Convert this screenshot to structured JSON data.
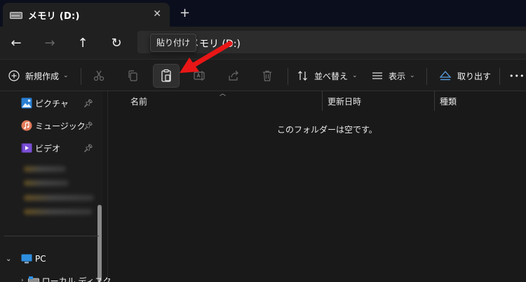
{
  "tab": {
    "title": "メモリ (D:)",
    "close": "✕",
    "new_tab": "+"
  },
  "nav": {
    "back": "←",
    "forward": "→",
    "up": "↑",
    "refresh": "↻"
  },
  "address": {
    "path": "メモリ (D:)",
    "bracket": "〔"
  },
  "tooltip": {
    "text": "貼り付け"
  },
  "toolbar": {
    "new_label": "新規作成",
    "sort_label": "並べ替え",
    "view_label": "表示",
    "eject_label": "取り出す",
    "more": "•••",
    "chevron": "⌄"
  },
  "sidebar": {
    "items": [
      {
        "label": "ピクチャ"
      },
      {
        "label": "ミュージック"
      },
      {
        "label": "ビデオ"
      }
    ],
    "pc_label": "PC",
    "disk_label": "ローカル ディスク"
  },
  "columns": {
    "name": "名前",
    "modified": "更新日時",
    "type": "種類"
  },
  "empty_message": "このフォルダーは空です。",
  "colors": {
    "accent_arrow": "#e81616",
    "tab_strip": "#0b0f1d",
    "background": "#191919"
  }
}
